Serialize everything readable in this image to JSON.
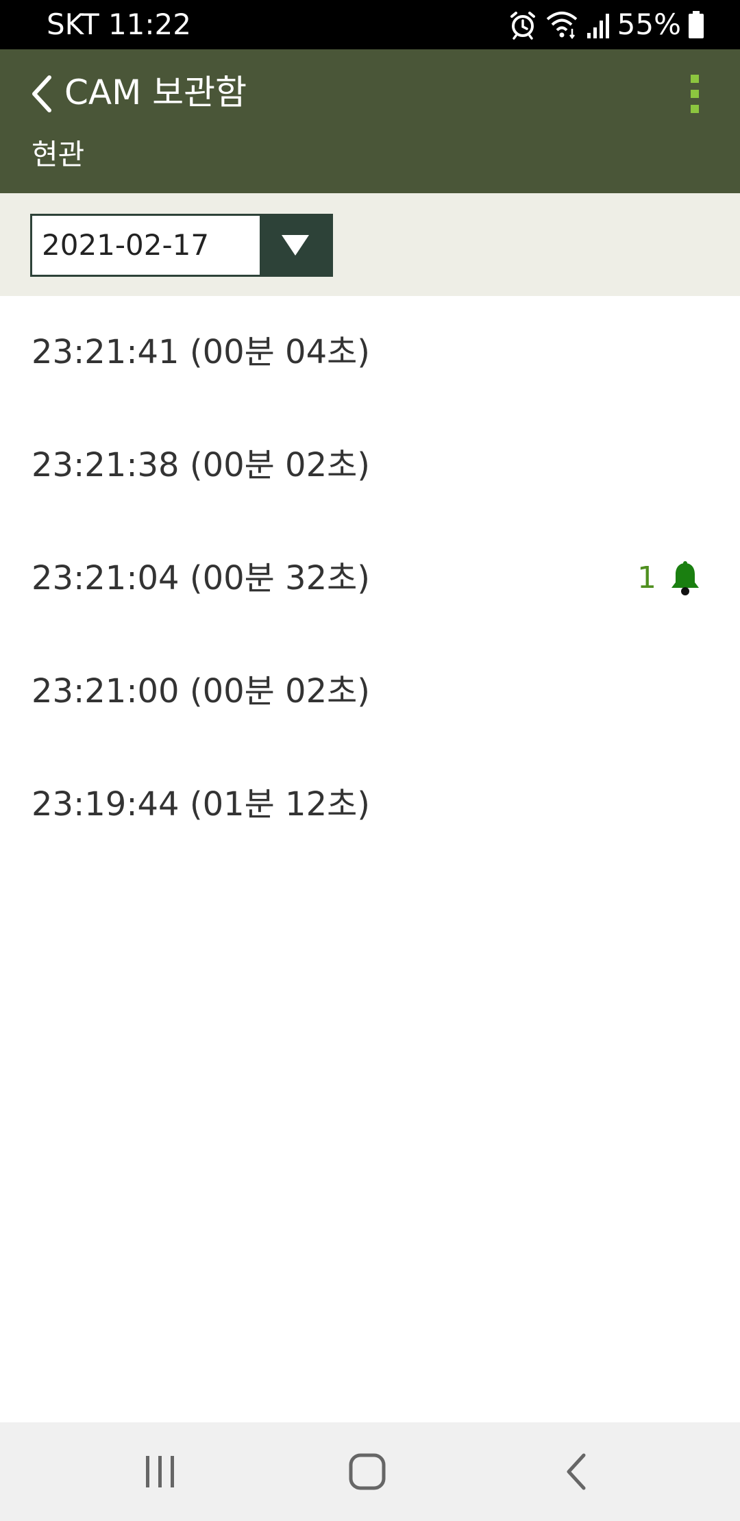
{
  "status_bar": {
    "carrier_time": "SKT 11:22",
    "battery_percent": "55%",
    "icons": [
      "alarm-icon",
      "wifi-icon",
      "signal-icon",
      "battery-icon"
    ]
  },
  "header": {
    "title": "CAM 보관함",
    "subtitle": "현관",
    "background_color": "#4a5638",
    "menu_dot_color": "#8cc63f"
  },
  "filter": {
    "selected_date": "2021-02-17",
    "accent_color": "#2d4238"
  },
  "records": [
    {
      "time": "23:21:41 (00분 04초)",
      "alert_count": null
    },
    {
      "time": "23:21:38 (00분 02초)",
      "alert_count": null
    },
    {
      "time": "23:21:04 (00분 32초)",
      "alert_count": "1"
    },
    {
      "time": "23:21:00 (00분 02초)",
      "alert_count": null
    },
    {
      "time": "23:19:44 (01분 12초)",
      "alert_count": null
    }
  ],
  "alert_color": "#1a7f10",
  "nav": {
    "icons": [
      "recent-apps-icon",
      "home-icon",
      "back-icon"
    ]
  }
}
